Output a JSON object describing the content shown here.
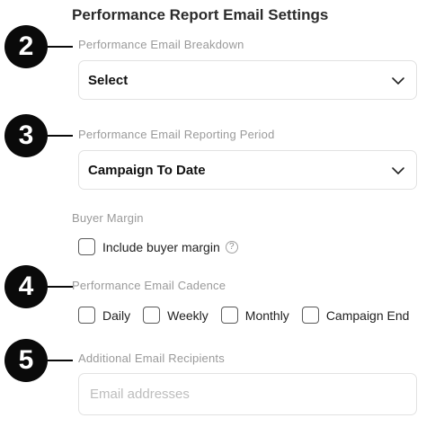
{
  "title": "Performance Report Email Settings",
  "steps": [
    "2",
    "3",
    "4",
    "5"
  ],
  "breakdown": {
    "label": "Performance Email Breakdown",
    "value": "Select"
  },
  "period": {
    "label": "Performance Email Reporting Period",
    "value": "Campaign To Date"
  },
  "buyer_margin": {
    "label": "Buyer Margin",
    "checkbox_label": "Include buyer margin",
    "help_icon": "?"
  },
  "cadence": {
    "label": "Performance Email Cadence",
    "options": [
      "Daily",
      "Weekly",
      "Monthly",
      "Campaign End"
    ]
  },
  "recipients": {
    "label": "Additional Email Recipients",
    "placeholder": "Email addresses"
  }
}
